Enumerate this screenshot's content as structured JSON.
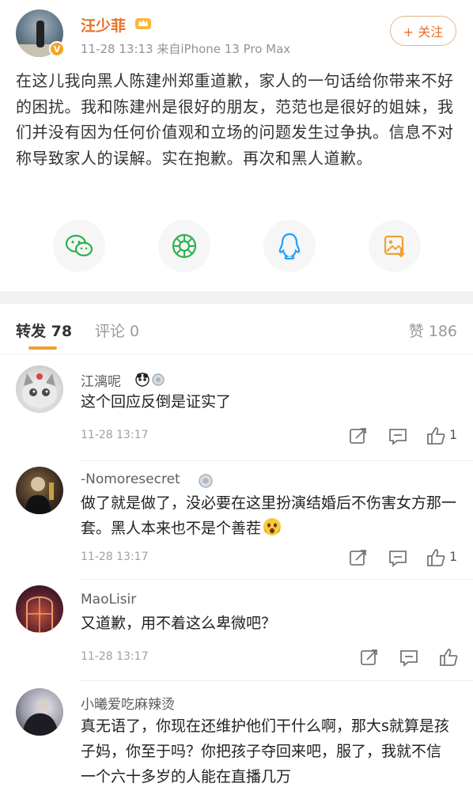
{
  "post": {
    "username": "汪少菲",
    "verified_badge": "V",
    "meta": "11-28 13:13  来自iPhone 13 Pro Max",
    "follow_label": "+ 关注",
    "body": "在这儿我向黑人陈建州郑重道歉，家人的一句话给你带来不好的困扰。我和陈建州是很好的朋友，范范也是很好的姐妹，我们并没有因为任何价值观和立场的问题发生过争执。信息不对称导致家人的误解。实在抱歉。再次和黑人道歉。",
    "share_icons": [
      "wechat-icon",
      "moments-icon",
      "qq-icon",
      "save-image-icon"
    ]
  },
  "tabs": {
    "reposts": "转发 78",
    "comments": "评论 0",
    "likes": "赞 186"
  },
  "comments": [
    {
      "name": "江漓呢",
      "text": "这个回应反倒是证实了",
      "time": "11-28 13:17",
      "likes": "1"
    },
    {
      "name": "-Nomoresecret",
      "text": "做了就是做了，没必要在这里扮演结婚后不伤害女方那一套。黑人本来也不是个善茬",
      "time": "11-28 13:17",
      "likes": "1"
    },
    {
      "name": "MaoLisir",
      "text": "又道歉，用不着这么卑微吧？",
      "time": "11-28 13:17",
      "likes": ""
    },
    {
      "name": "小曦爱吃麻辣烫",
      "text": "真无语了，你现在还维护他们干什么啊，那大s就算是孩子妈，你至于吗？你把孩子夺回来吧，服了，我就不信一个六十多岁的人能在直播几万",
      "time": "",
      "likes": ""
    }
  ],
  "colors": {
    "brand_orange": "#e8702a",
    "tab_underline": "#f0a030",
    "wechat_green": "#2bb24c",
    "qq_blue": "#1e9fff"
  }
}
